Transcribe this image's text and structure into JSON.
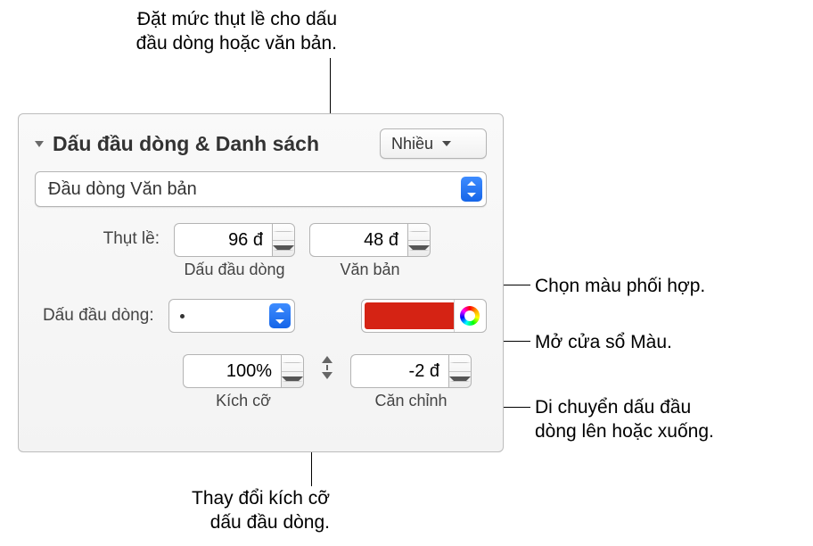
{
  "callouts": {
    "indent": "Đặt mức thụt lề cho dấu\nđầu dòng hoặc văn bản.",
    "chooseColor": "Chọn màu phối hợp.",
    "openColors": "Mở cửa sổ Màu.",
    "moveBullet": "Di chuyển dấu đầu\ndòng lên hoặc xuống.",
    "changeSize": "Thay đổi kích cỡ\ndấu đầu dòng."
  },
  "section": {
    "title": "Dấu đầu dòng & Danh sách",
    "styleMenu": "Nhiều",
    "bulletType": "Đầu dòng Văn bản"
  },
  "indent": {
    "label": "Thụt lề:",
    "bulletValue": "96 đ",
    "bulletCaption": "Dấu đầu dòng",
    "textValue": "48 đ",
    "textCaption": "Văn bản"
  },
  "bulletRow": {
    "label": "Dấu đầu dòng:"
  },
  "sizeRow": {
    "sizeValue": "100%",
    "sizeCaption": "Kích cỡ",
    "alignValue": "-2 đ",
    "alignCaption": "Căn chỉnh"
  }
}
